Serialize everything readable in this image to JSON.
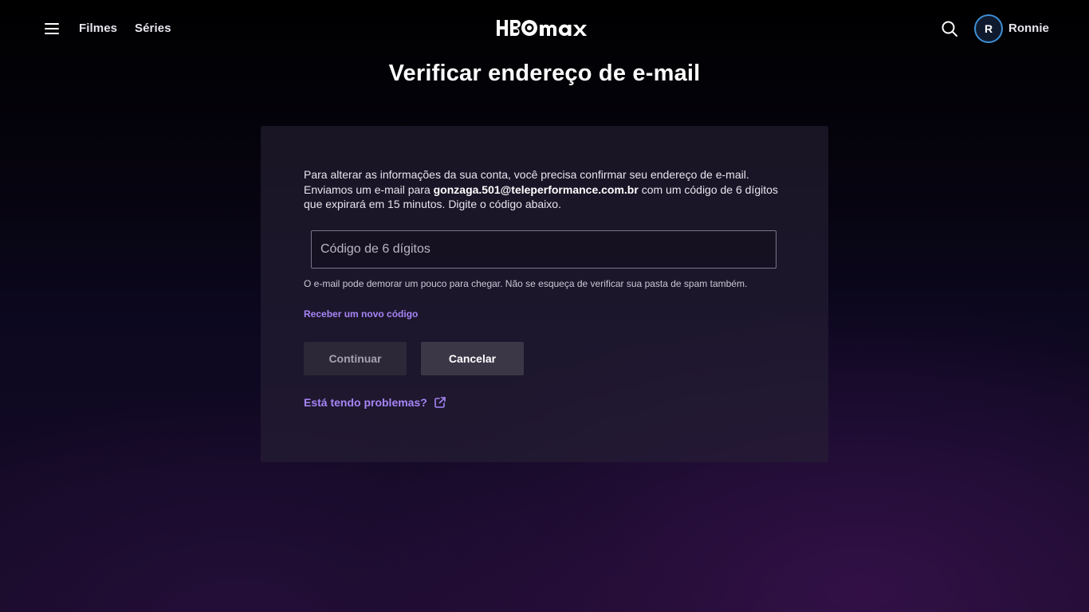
{
  "header": {
    "nav": [
      {
        "label": "Filmes"
      },
      {
        "label": "Séries"
      }
    ],
    "logo_text": "HBOMAX",
    "profile": {
      "initial": "R",
      "name": "Ronnie"
    },
    "icons": {
      "menu": "menu-icon",
      "search": "search-icon"
    }
  },
  "page": {
    "title": "Verificar endereço de e-mail"
  },
  "card": {
    "intro_before_email": "Para alterar as informações da sua conta, você precisa confirmar seu endereço de e-mail. Enviamos um e-mail para ",
    "email": "gonzaga.501@teleperformance.com.br",
    "intro_after_email": " com um código de 6 dígitos que expirará em 15 minutos. Digite o código abaixo.",
    "code_input": {
      "placeholder": "Código de 6 dígitos",
      "value": ""
    },
    "hint": "O e-mail pode demorar um pouco para chegar. Não se esqueça de verificar sua pasta de spam também.",
    "resend_label": "Receber um novo código",
    "continue_label": "Continuar",
    "cancel_label": "Cancelar",
    "help_label": "Está tendo problemas?",
    "help_icon": "external-link-icon"
  },
  "colors": {
    "accent_link": "#a685f5",
    "avatar_ring": "#3d8fd6",
    "background_top": "#000000",
    "background_bottom": "#180a28"
  }
}
